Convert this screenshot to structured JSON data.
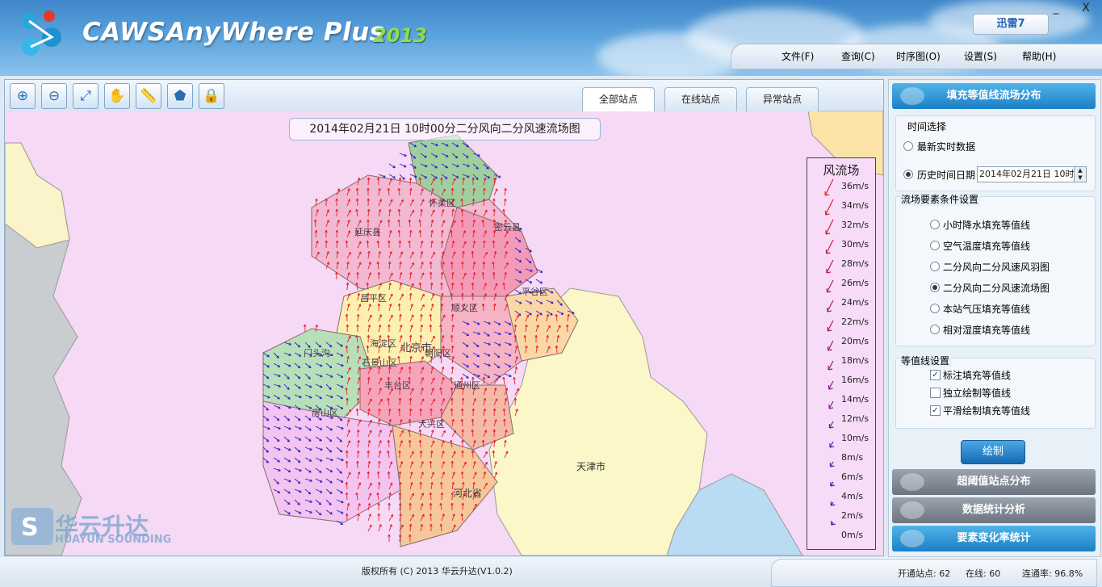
{
  "app": {
    "title": "CAWSAnyWhere Plus",
    "year": "2013",
    "badge": "迅雷7",
    "window_buttons": [
      "_",
      "X"
    ]
  },
  "menu": {
    "items": [
      "文件(F)",
      "查询(C)",
      "时序图(O)",
      "设置(S)",
      "帮助(H)"
    ]
  },
  "toolbar": {
    "tools": [
      "zoom-in-icon",
      "zoom-out-icon",
      "full-extent-icon",
      "pan-hand-icon",
      "ruler-icon",
      "polygon-icon",
      "lock-icon"
    ]
  },
  "tabs": {
    "items": [
      "全部站点",
      "在线站点",
      "异常站点"
    ],
    "active": "全部站点"
  },
  "map": {
    "title": "2014年02月21日  10时00分二分风向二分风速流场图",
    "labels": {
      "tianjin": "天津市",
      "hebei": "河北省",
      "yanqing": "延庆县",
      "huairou": "怀柔区",
      "miyun": "密云县",
      "pinggu": "平谷区",
      "changping": "昌平区",
      "shunyi": "顺义区",
      "mentougou": "门头沟",
      "haidian": "海淀区",
      "beijing": "北京市",
      "chaoyang": "朝阳区",
      "shijingshan": "石景山区",
      "fengtai": "丰台区",
      "tongzhou": "通州区",
      "fangshan": "房山区",
      "daxing": "大兴区"
    },
    "colors": {
      "background": "#f5d9f5",
      "tianjin": "#fbf7c9",
      "hebei_gray": "#c9cdcf",
      "sea": "#b9dcf2",
      "arrow_red": "#e8202a",
      "arrow_blue": "#3020c8"
    }
  },
  "legend": {
    "title": "风流场",
    "entries": [
      "36m/s",
      "34m/s",
      "32m/s",
      "30m/s",
      "28m/s",
      "26m/s",
      "24m/s",
      "22m/s",
      "20m/s",
      "18m/s",
      "16m/s",
      "14m/s",
      "12m/s",
      "10m/s",
      "8m/s",
      "6m/s",
      "4m/s",
      "2m/s",
      "0m/s"
    ]
  },
  "watermark": {
    "cn": "华云升达",
    "en": "HUAYUN SOUNDING"
  },
  "right_panel": {
    "header_main": "填充等值线流场分布",
    "time_group": {
      "title": "时间选择",
      "latest": "最新实时数据",
      "history": "历史时间日期",
      "selected": "历史时间日期",
      "date_value": "2014年02月21日 10时"
    },
    "element_group": {
      "title": "流场要素条件设置",
      "options": [
        "小时降水填充等值线",
        "空气温度填充等值线",
        "二分风向二分风速风羽图",
        "二分风向二分风速流场图",
        "本站气压填充等值线",
        "相对湿度填充等值线"
      ],
      "selected": "二分风向二分风速流场图"
    },
    "contour_group": {
      "title": "等值线设置",
      "options": [
        {
          "label": "标注填充等值线",
          "checked": true
        },
        {
          "label": "独立绘制等值线",
          "checked": false
        },
        {
          "label": "平滑绘制填充等值线",
          "checked": true
        }
      ]
    },
    "draw_button": "绘制",
    "sections": [
      "超阈值站点分布",
      "数据统计分析",
      "要素变化率统计"
    ]
  },
  "status": {
    "copyright": "版权所有 (C) 2013 华云升达(V1.0.2)",
    "open_stations": "开通站点: 62",
    "online": "在线: 60",
    "rate": "连通率: 96.8%"
  }
}
